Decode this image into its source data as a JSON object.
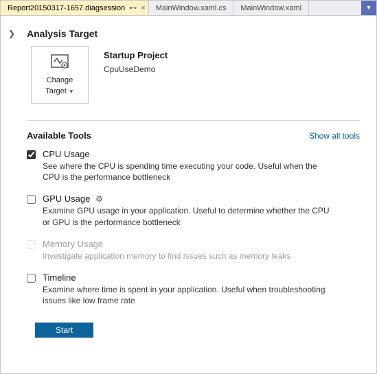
{
  "tabs": {
    "active": "Report20150317-1657.diagsession",
    "items": [
      "MainWindow.xaml.cs",
      "MainWindow.xaml"
    ]
  },
  "analysis": {
    "title": "Analysis Target",
    "change_label": "Change",
    "change_label2": "Target",
    "project_label": "Startup Project",
    "project_name": "CpuUseDemo"
  },
  "tools_section": {
    "title": "Available Tools",
    "show_all": "Show all tools"
  },
  "tools": [
    {
      "name": "CPU Usage",
      "desc": "See where the CPU is spending time executing your code. Useful when the CPU is the performance bottleneck",
      "checked": true,
      "disabled": false,
      "has_gear": false
    },
    {
      "name": "GPU Usage",
      "desc": "Examine GPU usage in your application. Useful to determine whether the CPU or GPU is the performance bottleneck",
      "checked": false,
      "disabled": false,
      "has_gear": true
    },
    {
      "name": "Memory Usage",
      "desc": "Investigate application memory to find issues such as memory leaks",
      "checked": false,
      "disabled": true,
      "has_gear": false
    },
    {
      "name": "Timeline",
      "desc": "Examine where time is spent in your application. Useful when troubleshooting issues like low frame rate",
      "checked": false,
      "disabled": false,
      "has_gear": false
    }
  ],
  "start_label": "Start"
}
